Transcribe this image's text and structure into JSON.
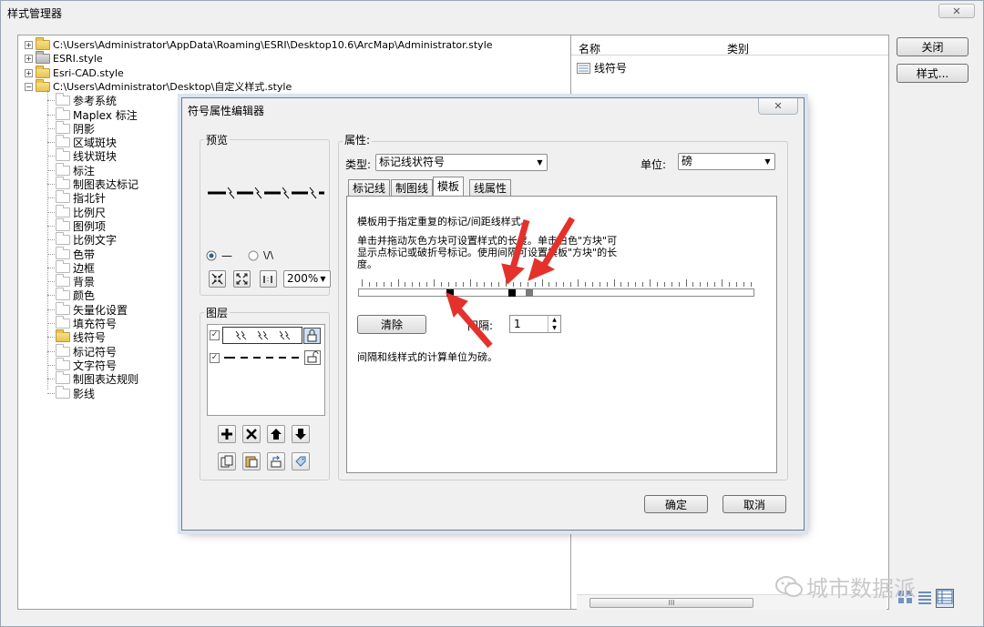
{
  "window": {
    "title": "样式管理器",
    "close_label": "✕",
    "close_button": "关闭",
    "styles_button": "样式..."
  },
  "tree": {
    "roots": [
      {
        "label": "C:\\Users\\Administrator\\AppData\\Roaming\\ESRI\\Desktop10.6\\ArcMap\\Administrator.style",
        "expander": "+"
      },
      {
        "label": "ESRI.style",
        "expander": "+"
      },
      {
        "label": "Esri-CAD.style",
        "expander": "+"
      },
      {
        "label": "C:\\Users\\Administrator\\Desktop\\自定义样式.style",
        "expander": "−"
      }
    ],
    "children": [
      "参考系统",
      "Maplex 标注",
      "阴影",
      "区域斑块",
      "线状斑块",
      "标注",
      "制图表达标记",
      "指北针",
      "比例尺",
      "图例项",
      "比例文字",
      "色带",
      "边框",
      "背景",
      "颜色",
      "矢量化设置",
      "填充符号",
      "线符号",
      "标记符号",
      "文字符号",
      "制图表达规则",
      "影线"
    ],
    "selected_child": "线符号"
  },
  "list": {
    "col_name": "名称",
    "col_category": "类别",
    "items": [
      "线符号"
    ],
    "scroll_thumb": "III"
  },
  "dialog": {
    "title": "符号属性编辑器",
    "close_label": "✕",
    "preview_label": "预览",
    "radio_line": "—",
    "radio_curve": "\\/\\",
    "zoom_value": "200%",
    "layers_label": "图层",
    "properties_label": "属性:",
    "type_label": "类型:",
    "type_value": "标记线状符号",
    "unit_label": "单位:",
    "unit_value": "磅",
    "tabs": [
      "标记线",
      "制图线",
      "模板",
      "线属性"
    ],
    "active_tab": "模板",
    "template_desc": "模板用于指定重复的标记/间距线样式。",
    "template_help": "单击并拖动灰色方块可设置样式的长度。单击白色\"方块\"可显示点标记或破折号标记。使用间隔可设置模板\"方块\"的长度。",
    "clear_button": "清除",
    "interval_label": "间隔:",
    "interval_value": "1",
    "unit_note": "间隔和线样式的计算单位为磅。",
    "ok_button": "确定",
    "cancel_button": "取消"
  },
  "watermark": "城市数据派",
  "colors": {
    "arrow": "#e4312b",
    "accent": "#2b6cb0"
  }
}
